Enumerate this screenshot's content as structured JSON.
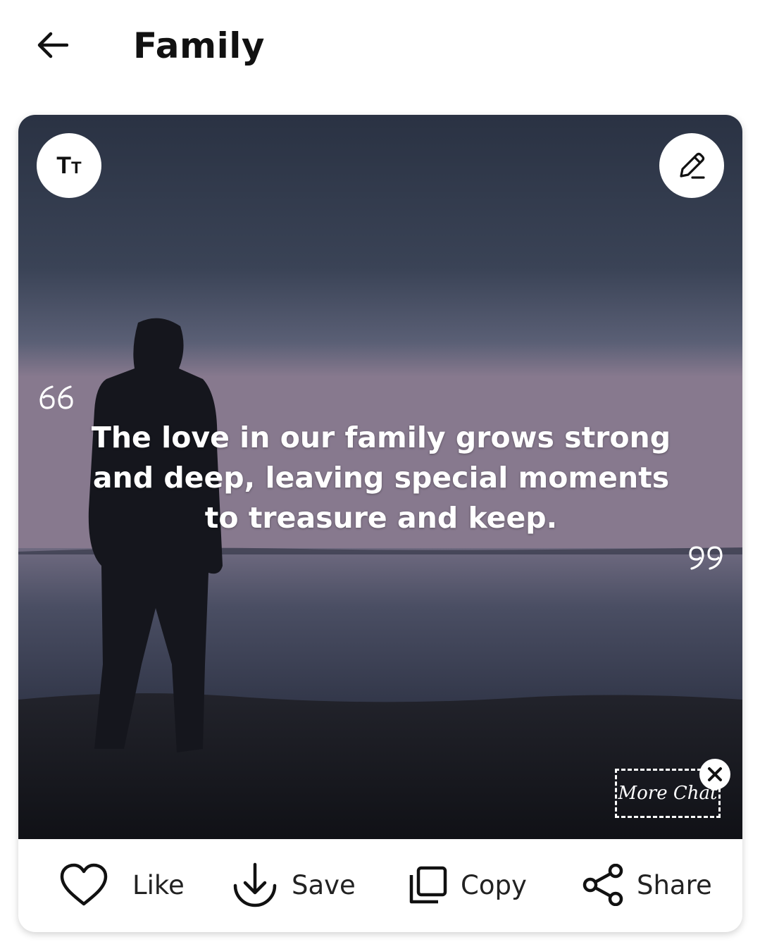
{
  "header": {
    "title": "Family"
  },
  "quote": {
    "text": "The love in our family grows strong and deep, leaving special moments to treasure and keep."
  },
  "buttons": {
    "font": "Tт"
  },
  "watermark": {
    "label": "More Chat"
  },
  "actions": [
    {
      "label": "Like",
      "icon": "heart-icon"
    },
    {
      "label": "Save",
      "icon": "download-icon"
    },
    {
      "label": "Copy",
      "icon": "copy-icon"
    },
    {
      "label": "Share",
      "icon": "share-icon"
    }
  ],
  "colors": {
    "sky_top": "#2b3447",
    "sky_mid": "#4a5167",
    "horizon": "#8a7f93",
    "water": "#3e4358",
    "ground": "#15161c"
  }
}
